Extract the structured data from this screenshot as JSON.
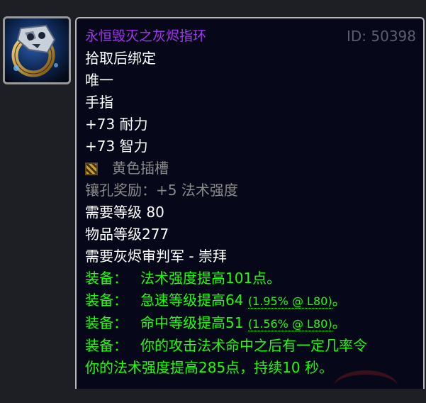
{
  "item": {
    "name": "永恒毁灭之灰烬指环",
    "id_label": "ID: 50398",
    "icon": "ring-icon",
    "name_color": "#a335ee",
    "lines": {
      "bind": "拾取后绑定",
      "unique": "唯一",
      "slot": "手指",
      "stamina": "+73 耐力",
      "intellect": "+73 智力",
      "socket": "黄色插槽",
      "socket_bonus": "镶孔奖励：+5 法术强度",
      "req_level": "需要等级 80",
      "item_level": "物品等级277",
      "req_rep": "需要灰烬审判军 - 崇拜"
    },
    "equip": {
      "label": "装备：",
      "spell_power": "法术强度提高101点。",
      "haste_text": "急速等级提高64",
      "haste_pct": "(1.95% @ L80)",
      "hit_text": "命中等级提高51",
      "hit_pct": "(1.56% @ L80)",
      "proc_line1": "你的攻击法术命中之后有一定几率令",
      "proc_line2": "你的法术强度提高285点，持续10 秒。",
      "end_mark": "。",
      "color": "#1eff00"
    }
  }
}
